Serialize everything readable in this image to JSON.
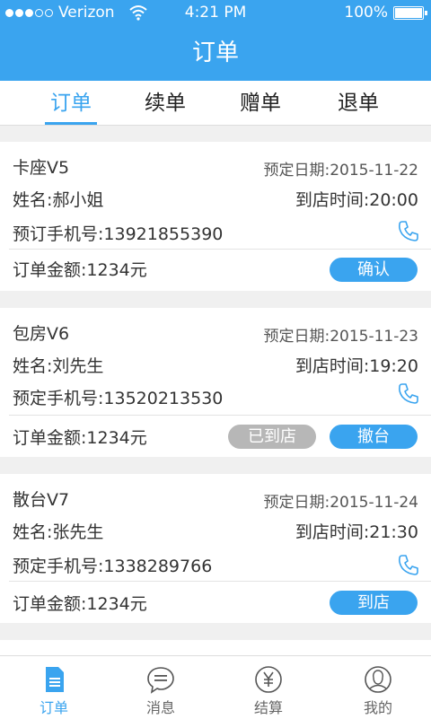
{
  "status_bar": {
    "carrier": "Verizon",
    "time": "4:21 PM",
    "battery": "100%"
  },
  "nav": {
    "title": "订单"
  },
  "tabs": [
    {
      "label": "订单"
    },
    {
      "label": "续单"
    },
    {
      "label": "赠单"
    },
    {
      "label": "退单"
    }
  ],
  "orders": [
    {
      "room": "卡座V5",
      "date": "预定日期:2015-11-22",
      "name": "姓名:郝小姐",
      "arrival": "到店时间:20:00",
      "phone": "预订手机号:13921855390",
      "amount": "订单金额:1234元",
      "buttons": [
        {
          "label": "确认",
          "style": "primary"
        }
      ]
    },
    {
      "room": "包房V6",
      "date": "预定日期:2015-11-23",
      "name": "姓名:刘先生",
      "arrival": "到店时间:19:20",
      "phone": "预定手机号:13520213530",
      "amount": "订单金额:1234元",
      "buttons": [
        {
          "label": "已到店",
          "style": "gray"
        },
        {
          "label": "撤台",
          "style": "primary"
        }
      ]
    },
    {
      "room": "散台V7",
      "date": "预定日期:2015-11-24",
      "name": "姓名:张先生",
      "arrival": "到店时间:21:30",
      "phone": "预定手机号:1338289766",
      "amount": "订单金额:1234元",
      "buttons": [
        {
          "label": "到店",
          "style": "primary"
        }
      ]
    }
  ],
  "bottom_tabs": [
    {
      "label": "订单",
      "icon": "order-doc-icon"
    },
    {
      "label": "消息",
      "icon": "message-icon"
    },
    {
      "label": "结算",
      "icon": "yuan-icon"
    },
    {
      "label": "我的",
      "icon": "profile-icon"
    }
  ],
  "colors": {
    "accent": "#3aa4ef",
    "gray_button": "#b7b7b7",
    "background": "#f0f0f0"
  }
}
